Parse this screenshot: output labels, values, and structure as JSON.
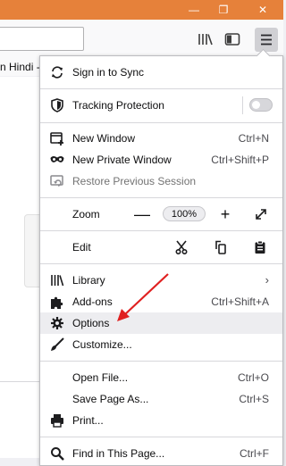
{
  "window_controls": {
    "minimize": "—",
    "restore": "❐",
    "close": "✕"
  },
  "bookmark_fragment": "n Hindi -",
  "menu": {
    "sign_in": "Sign in to Sync",
    "tracking": "Tracking Protection",
    "new_window": {
      "label": "New Window",
      "shortcut": "Ctrl+N"
    },
    "new_private": {
      "label": "New Private Window",
      "shortcut": "Ctrl+Shift+P"
    },
    "restore": "Restore Previous Session",
    "zoom": {
      "label": "Zoom",
      "minus": "—",
      "value": "100%",
      "plus": "+"
    },
    "edit": "Edit",
    "library": "Library",
    "addons": {
      "label": "Add-ons",
      "shortcut": "Ctrl+Shift+A"
    },
    "options": "Options",
    "customize": "Customize...",
    "open_file": {
      "label": "Open File...",
      "shortcut": "Ctrl+O"
    },
    "save_page": {
      "label": "Save Page As...",
      "shortcut": "Ctrl+S"
    },
    "print": "Print...",
    "find": {
      "label": "Find in This Page...",
      "shortcut": "Ctrl+F"
    }
  },
  "colors": {
    "titlebar": "#e6813a",
    "highlight": "#ededf0",
    "arrow": "#e02020"
  }
}
